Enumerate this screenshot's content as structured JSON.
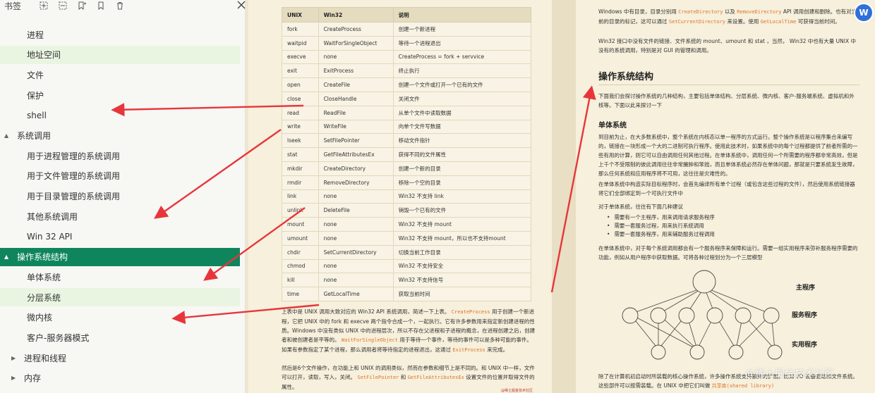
{
  "sidebar": {
    "title": "书签",
    "toolbar_icons": [
      "expand-icon",
      "collapse-icon",
      "add-bookmark-icon",
      "bookmark-icon",
      "trash-icon"
    ],
    "items": [
      {
        "label": "进程",
        "level": 2
      },
      {
        "label": "地址空间",
        "level": 2,
        "highlight": true
      },
      {
        "label": "文件",
        "level": 2
      },
      {
        "label": "保护",
        "level": 2
      },
      {
        "label": "shell",
        "level": 2
      },
      {
        "label": "系统调用",
        "level": 1,
        "caret": "▲"
      },
      {
        "label": "用于进程管理的系统调用",
        "level": 2
      },
      {
        "label": "用于文件管理的系统调用",
        "level": 2
      },
      {
        "label": "用于目录管理的系统调用",
        "level": 2
      },
      {
        "label": "其他系统调用",
        "level": 2
      },
      {
        "label": "Win 32 API",
        "level": 2
      },
      {
        "label": "操作系统结构",
        "level": 1,
        "caret": "▲",
        "active": true
      },
      {
        "label": "单体系统",
        "level": 2
      },
      {
        "label": "分层系统",
        "level": 2,
        "highlight": true
      },
      {
        "label": "微内核",
        "level": 2
      },
      {
        "label": "客户-服务器模式",
        "level": 2
      },
      {
        "label": "进程和线程",
        "level": 0,
        "caret": "▶"
      },
      {
        "label": "内存",
        "level": 0,
        "caret": "▶"
      }
    ]
  },
  "table": {
    "headers": [
      "UNIX",
      "Win32",
      "说明"
    ],
    "rows": [
      [
        "fork",
        "CreateProcess",
        "创建一个新进程"
      ],
      [
        "waitpid",
        "WaitForSingleObject",
        "等待一个进程退出"
      ],
      [
        "execve",
        "none",
        "CreateProcess = fork + servvice"
      ],
      [
        "exit",
        "ExitProcess",
        "终止执行"
      ],
      [
        "open",
        "CreateFile",
        "创建一个文件或打开一个已有的文件"
      ],
      [
        "close",
        "CloseHandle",
        "关闭文件"
      ],
      [
        "read",
        "ReadFile",
        "从单个文件中读取数据"
      ],
      [
        "write",
        "WriteFile",
        "向单个文件写数据"
      ],
      [
        "lseek",
        "SetFilePointer",
        "移动文件指针"
      ],
      [
        "stat",
        "GetFileAttributesEx",
        "获得不同的文件属性"
      ],
      [
        "mkdir",
        "CreateDirectory",
        "创建一个新的目录"
      ],
      [
        "rmdir",
        "RemoveDirectory",
        "移除一个空的目录"
      ],
      [
        "link",
        "none",
        "Win32 不支持 link"
      ],
      [
        "unlink",
        "DeleteFile",
        "销毁一个已有的文件"
      ],
      [
        "mount",
        "none",
        "Win32 不支持 mount"
      ],
      [
        "umount",
        "none",
        "Win32 不支持 mount，所以也不支持mount"
      ],
      [
        "chdir",
        "SetCurrentDirectory",
        "切换当前工作目录"
      ],
      [
        "chmod",
        "none",
        "Win32 不支持安全"
      ],
      [
        "kill",
        "none",
        "Win32 不支持信号"
      ],
      [
        "time",
        "GetLocalTime",
        "获取当前时间"
      ]
    ]
  },
  "left_page": {
    "para1_a": "上表中是 UNIX 调用大致对应的 Win32 API 系统调用，简述一下上表。",
    "para1_code1": "CreateProcess",
    "para1_b": "用于创建一个新进程，它把 UNIX 中的 fork 和 execve 两个指令合成一个，一起执行。它有许多参数用来指定新创建进程的性质。Windows 中没有类似 UNIX 中的进程层次，所以不存在父进程和子进程的概念，在进程创建之后，创建者和被创建者是平等的。",
    "para1_code2": "WaitForSingleObject",
    "para1_c": "用于等待一个事件，等待的事件可以是多种可能的事件。如果有参数指定了某个进程，那么调用者将等待指定的进程退出，这通过",
    "para1_code3": "ExitProcess",
    "para1_d": "来完成。",
    "para2_a": "然后是6个文件操作，在功能上和 UNIX 的调用类似，然而在参数和细节上是不同的。和 UNIX 中一样，文件可以打开，读取，写入，关闭。",
    "para2_code1": "SetFilePointer",
    "para2_and": "和",
    "para2_code2": "GetFileAttributesEx",
    "para2_b": "设置文件的位置并取得文件的属性。",
    "footnote": "@稀土掘金技术社区"
  },
  "right_page": {
    "para1_a": "Windows 中有目录，目录分别用",
    "para1_code1": "CreateDirectory",
    "para1_and": "以及",
    "para1_code2": "RemoveDirectory",
    "para1_b": "API 调用创建和删除。也有对当前的目录的标记，这可以通过",
    "para1_code3": "SetCurrentDirectory",
    "para1_c": "来设置。使用",
    "para1_code4": "GetLocalTime",
    "para1_d": "可获得当前时间。",
    "para2": "Win32 接口中没有文件的链接、文件系统的 mount、umount 和 stat ，当然， Win32 中也有大量 UNIX 中没有的系统调用，特别是对 GUI 的管理和调用。",
    "h1": "操作系统结构",
    "para3": "下面我们会探讨操作系统的几种结构，主要包括单体结构、分层系统、微内核、客户-服务端系统、虚拟机和外核等。下面以此来探讨一下",
    "h2": "单体系统",
    "para4": "到目前为止，在大多数系统中，整个系统在内核态以单一程序的方式运行。整个操作系统是以程序集合来编写的，链接在一块形成一个大的二进制可执行程序。使用此技术时，如果系统中的每个过程都提供了前者所需的一些有用的计算，则它可以自由调用任何其他过程。在单体系统中，调用任何一个所需要的程序都非常高效，但是上千个不受限制的彼此调用往往非常臃肿和笨拙，而且单体系统必然存在单体问题，那就是只要系统发生故障，那么任何系统和应用程序将不可用，这往往是灾难性的。",
    "para5": "在单体系统中构造实际目标程序时，会首先编译所有单个过程（或包含这些过程的文件），然后使用系统链接器将它们全部绑定到一个可执行文件中",
    "para6": "对于单体系统，往往有下面几种建议",
    "list": [
      "需要有一个主程序，用来调用请求服务程序",
      "需要一套服务过程，用来执行系统调用",
      "需要一套服务程序，用来辅助服务过程调用"
    ],
    "para7": "在单体系统中，对于每个系统调用都会有一个服务程序来保障和运行。需要一组实用程序来弥补服务程序需要的功能，例如从用户程序中获取数据。可将各种过程划分为一个三层模型",
    "diagram_labels": [
      "主程序",
      "服务程序",
      "实用程序"
    ],
    "para8": "除了在计算机初启动时所装载的核心操作系统，许多操作系统支持额外的扩展。比如 I/O 设备驱动和文件系统。这些部件可以按需装载。在 UNIX 中把它们叫做",
    "para8_code": "共享库(shared library)",
    "app_badge": "W",
    "watermark": "@稀土掘金技术社区"
  }
}
